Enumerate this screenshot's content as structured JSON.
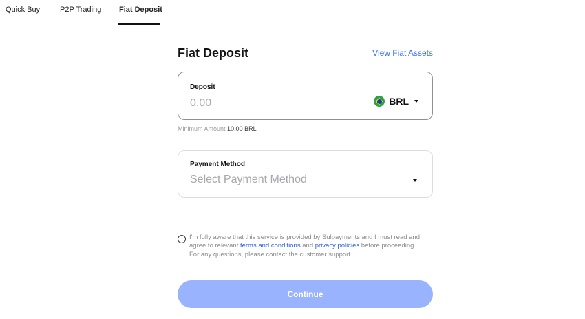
{
  "tabs": [
    {
      "label": "Quick Buy"
    },
    {
      "label": "P2P Trading"
    },
    {
      "label": "Fiat Deposit",
      "active": true
    }
  ],
  "header": {
    "title": "Fiat Deposit",
    "assets_link": "View Fiat Assets"
  },
  "deposit": {
    "label": "Deposit",
    "placeholder": "0.00",
    "currency": "BRL",
    "currency_icon": "brazil-flag-icon",
    "minimum_label": "Minimum Amount",
    "minimum_value": "10.00 BRL"
  },
  "payment": {
    "label": "Payment Method",
    "placeholder": "Select Payment Method"
  },
  "consent": {
    "text_before": "I'm fully aware that this service is provided by Sulpayments and I must read and agree to relevant ",
    "terms_link": "terms and conditions",
    "text_middle": " and ",
    "privacy_link": "privacy policies",
    "text_after": " before proceeding. For any questions, please contact the customer support."
  },
  "actions": {
    "continue_label": "Continue"
  },
  "colors": {
    "accent": "#3b6ff5",
    "button_disabled": "#99b3ff"
  }
}
